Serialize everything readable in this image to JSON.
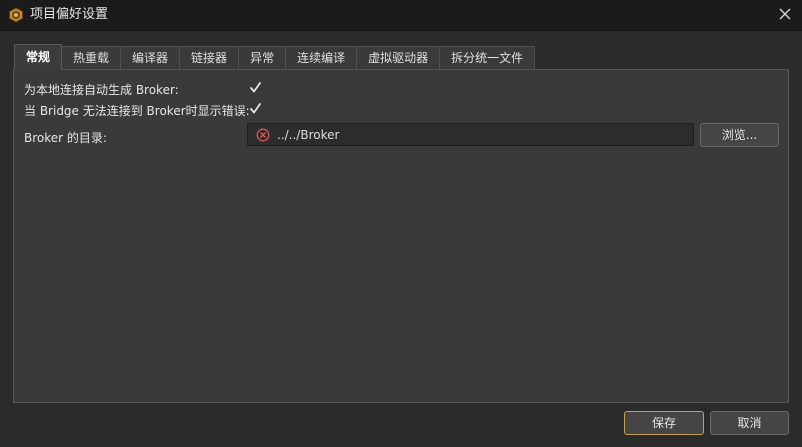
{
  "window": {
    "title": "项目偏好设置",
    "icon": "app-logo-icon",
    "close_icon": "close-icon"
  },
  "tabs": [
    {
      "label": "常规",
      "active": true
    },
    {
      "label": "热重载",
      "active": false
    },
    {
      "label": "编译器",
      "active": false
    },
    {
      "label": "链接器",
      "active": false
    },
    {
      "label": "异常",
      "active": false
    },
    {
      "label": "连续编译",
      "active": false
    },
    {
      "label": "虚拟驱动器",
      "active": false
    },
    {
      "label": "拆分统一文件",
      "active": false
    }
  ],
  "general": {
    "auto_generate_broker": {
      "label": "为本地连接自动生成 Broker:",
      "checked": true
    },
    "show_error_on_fail": {
      "label": "当 Bridge 无法连接到 Broker时显示错误:",
      "checked": true
    },
    "broker_dir": {
      "label": "Broker 的目录:",
      "value": "../../Broker",
      "status_icon": "error-circle-icon"
    },
    "browse_label": "浏览..."
  },
  "footer": {
    "save_label": "保存",
    "cancel_label": "取消"
  },
  "colors": {
    "background": "#2b2b2b",
    "titlebar": "#1b1b1b",
    "panel": "#3a3a3a",
    "accent_border": "#c9a14e",
    "error": "#e0525c"
  }
}
